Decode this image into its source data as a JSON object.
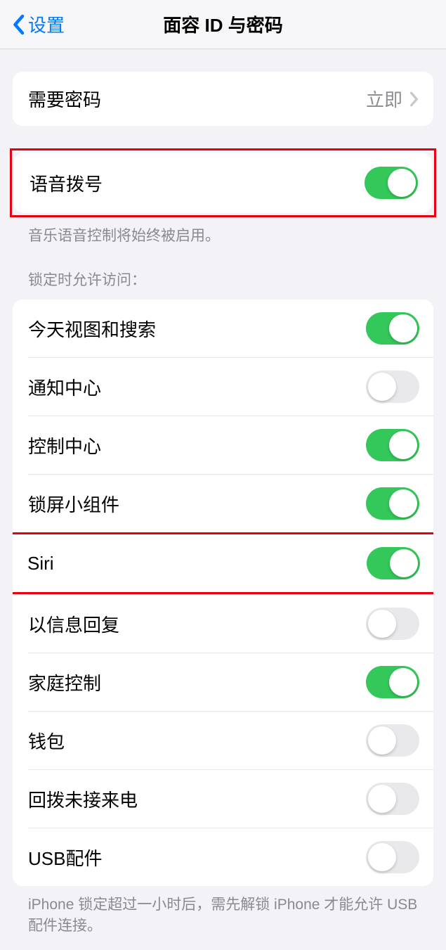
{
  "nav": {
    "back_label": "设置",
    "title": "面容 ID 与密码"
  },
  "require_passcode": {
    "label": "需要密码",
    "value": "立即"
  },
  "voice_dial": {
    "label": "语音拨号",
    "on": true,
    "footer": "音乐语音控制将始终被启用。"
  },
  "lock_screen_header": "锁定时允许访问：",
  "lock_items": [
    {
      "label": "今天视图和搜索",
      "on": true,
      "highlighted": false
    },
    {
      "label": "通知中心",
      "on": false,
      "highlighted": false
    },
    {
      "label": "控制中心",
      "on": true,
      "highlighted": false
    },
    {
      "label": "锁屏小组件",
      "on": true,
      "highlighted": false
    },
    {
      "label": "Siri",
      "on": true,
      "highlighted": true
    },
    {
      "label": "以信息回复",
      "on": false,
      "highlighted": false
    },
    {
      "label": "家庭控制",
      "on": true,
      "highlighted": false
    },
    {
      "label": "钱包",
      "on": false,
      "highlighted": false
    },
    {
      "label": "回拨未接来电",
      "on": false,
      "highlighted": false
    },
    {
      "label": "USB配件",
      "on": false,
      "highlighted": false
    }
  ],
  "usb_footer": "iPhone 锁定超过一小时后，需先解锁 iPhone 才能允许 USB 配件连接。",
  "colors": {
    "accent_blue": "#007aff",
    "toggle_green": "#34c759",
    "highlight_red": "#e60012"
  }
}
